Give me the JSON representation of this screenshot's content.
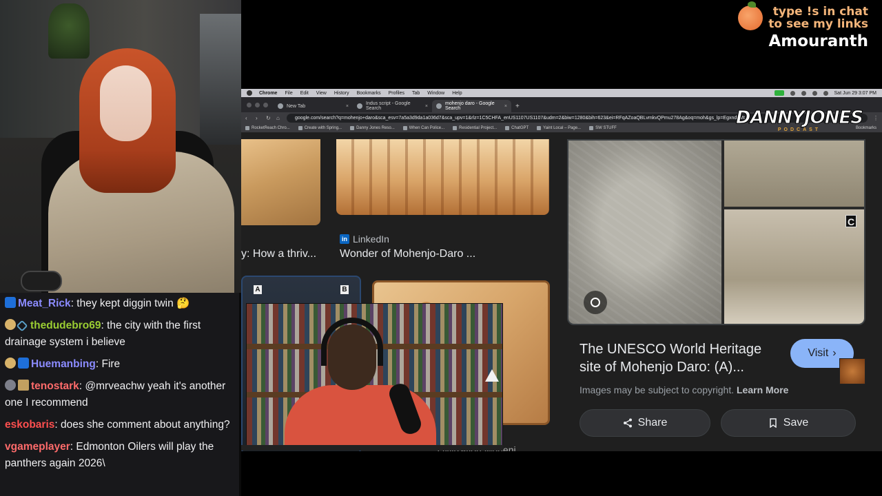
{
  "overlay": {
    "line1": "type !s in chat",
    "line2": "to see my links",
    "name": "Amouranth"
  },
  "chat": {
    "messages": [
      {
        "user": "Meat_Rick",
        "color": "#8b8bff",
        "text": ": they kept diggin twin 🤔",
        "badges": [
          "crown"
        ]
      },
      {
        "user": "thedudebro69",
        "color": "#9acd32",
        "text": ": the city with the first drainage system i believe",
        "badges": [
          "emote",
          "diamond"
        ]
      },
      {
        "user": "Huemanbing",
        "color": "#8b8bff",
        "text": ": Fire",
        "badges": [
          "emote",
          "crown"
        ]
      },
      {
        "user": "tenostark",
        "color": "#ff6b6b",
        "text": ": @mrveachw yeah it's another one I recommend",
        "badges": [
          "gray",
          "wizard"
        ]
      },
      {
        "user": "eskobaris",
        "color": "#ff4f4f",
        "text": ": does she comment about anything?",
        "badges": []
      },
      {
        "user": "vgameplayer",
        "color": "#ff6b6b",
        "text": ": Edmonton Oilers will play the panthers again 2026\\",
        "badges": []
      }
    ]
  },
  "menubar": {
    "app": "Chrome",
    "items": [
      "File",
      "Edit",
      "View",
      "History",
      "Bookmarks",
      "Profiles",
      "Tab",
      "Window",
      "Help"
    ],
    "clock": "Sat Jun 29  3:07 PM"
  },
  "tabs": [
    {
      "label": "New Tab",
      "active": false
    },
    {
      "label": "Indus script - Google Search",
      "active": false
    },
    {
      "label": "mohenjo daro - Google Search",
      "active": true
    }
  ],
  "omnibox": {
    "url": "google.com/search?q=mohenjo+daro&sca_esv=7a5a3d9da1a036d7&sca_upv=1&rlz=1C5CHFA_enUS1107US1107&udm=2&biw=1280&bih=623&ei=RFqAZoaQBLvmkvQPmu278Ag&oq=moh&gs_lp=Egxnd3Mt"
  },
  "bookmarks": [
    "RocketReach Chro...",
    "Create with Spring...",
    "Danny Jones Reso...",
    "When Can Police...",
    "Residential Project...",
    "ChatGPT",
    "Yaint Local – Page...",
    "SW STUFF"
  ],
  "bookmarks_right": "Bookmarks",
  "logo": {
    "main": "DANNYJONES",
    "sub": "PODCAST"
  },
  "results": {
    "left_title": "y: How a thriv...",
    "mid_source": "LinkedIn",
    "mid_title": "Wonder of Mohenjo-Daro ...",
    "label_a": "A",
    "label_b": "B",
    "cut_caption": "civilization  Mohenj"
  },
  "panel": {
    "corner_label": "C",
    "title": "The UNESCO World Heritage site of Mohenjo Daro: (A)...",
    "visit": "Visit",
    "copyright": "Images may be subject to copyright.",
    "learn_more": "Learn More",
    "share": "Share",
    "save": "Save"
  }
}
